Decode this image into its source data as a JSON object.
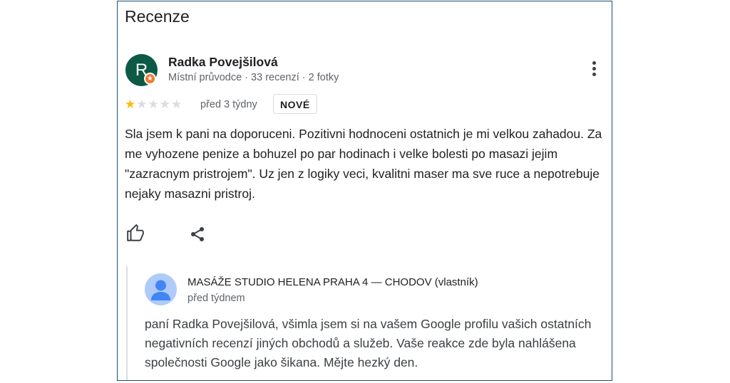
{
  "section": {
    "title": "Recenze"
  },
  "review": {
    "avatar_letter": "R",
    "badge_icon": "local-guide-star",
    "name": "Radka Povejšilová",
    "meta": "Místní průvodce · 33 recenzí · 2 fotky",
    "rating": 1,
    "rating_max": 5,
    "date": "před 3 týdny",
    "badge": "NOVÉ",
    "text": "Sla jsem k pani na doporuceni. Pozitivni hodnoceni ostatnich je mi velkou zahadou. Za me vyhozene penize a bohuzel po par hodinach i velke bolesti po masazi jejim \"zazracnym pristrojem\". Uz jen z logiky veci, kvalitni maser ma sve ruce a nepotrebuje nejaky masazni pristroj.",
    "actions": {
      "like_icon": "thumb-up-icon",
      "share_icon": "share-icon",
      "more_icon": "more-vert-icon"
    }
  },
  "owner_reply": {
    "avatar_icon": "person-icon",
    "name": "MASÁŽE STUDIO HELENA PRAHA 4 — CHODOV (vlastník)",
    "date": "před týdnem",
    "text": "paní Radka Povejšilová, všimla jsem si na vašem Google profilu vašich ostatních negativních recenzí jiných obchodů a služeb. Vaše reakce zde byla nahlášena společnosti Google jako šikana. Mějte hezký den."
  },
  "colors": {
    "avatar_bg": "#0c5a46",
    "badge_bg": "#f07a30",
    "star_filled": "#fbbc04",
    "star_empty": "#dadce0",
    "owner_avatar_bg": "#aecbfa",
    "owner_avatar_fg": "#4285f4",
    "card_border": "#1f4e79"
  }
}
